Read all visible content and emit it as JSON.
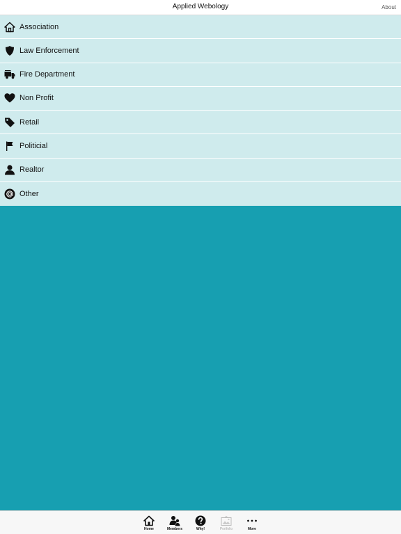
{
  "header": {
    "title": "Applied Webology",
    "about": "About"
  },
  "categories": [
    {
      "label": "Association",
      "icon": "house-icon"
    },
    {
      "label": "Law Enforcement",
      "icon": "shield-icon"
    },
    {
      "label": "Fire Department",
      "icon": "truck-icon"
    },
    {
      "label": "Non Profit",
      "icon": "heart-icon"
    },
    {
      "label": "Retail",
      "icon": "tag-icon"
    },
    {
      "label": "Politicial",
      "icon": "flag-icon"
    },
    {
      "label": "Realtor",
      "icon": "person-icon"
    },
    {
      "label": "Other",
      "icon": "at-icon"
    }
  ],
  "tabs": [
    {
      "label": "Home",
      "icon": "home-icon",
      "enabled": true
    },
    {
      "label": "Members",
      "icon": "members-icon",
      "enabled": true
    },
    {
      "label": "Why!",
      "icon": "question-icon",
      "enabled": true
    },
    {
      "label": "Portfolio",
      "icon": "portfolio-icon",
      "enabled": false
    },
    {
      "label": "More",
      "icon": "more-icon",
      "enabled": true
    }
  ],
  "colors": {
    "background": "#179fb1",
    "list_row": "#cfebed",
    "header": "#ffffff",
    "tabbar": "#f7f7f7"
  }
}
